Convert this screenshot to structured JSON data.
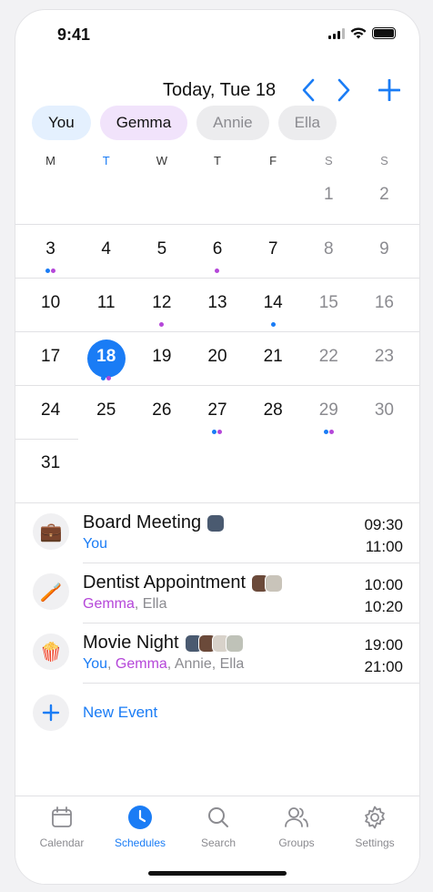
{
  "status_bar": {
    "time": "9:41"
  },
  "header": {
    "title": "Today, Tue 18"
  },
  "people": [
    {
      "name": "You",
      "state": "active",
      "color": "#1a7cf5"
    },
    {
      "name": "Gemma",
      "state": "active",
      "color": "#b547d9"
    },
    {
      "name": "Annie",
      "state": "inactive"
    },
    {
      "name": "Ella",
      "state": "inactive"
    }
  ],
  "calendar": {
    "weekdays": [
      "M",
      "T",
      "W",
      "T",
      "F",
      "S",
      "S"
    ],
    "today": 18,
    "weeks": [
      [
        null,
        null,
        null,
        null,
        null,
        "1",
        "2"
      ],
      [
        "3",
        "4",
        "5",
        "6",
        "7",
        "8",
        "9"
      ],
      [
        "10",
        "11",
        "12",
        "13",
        "14",
        "15",
        "16"
      ],
      [
        "17",
        "18",
        "19",
        "20",
        "21",
        "22",
        "23"
      ],
      [
        "24",
        "25",
        "26",
        "27",
        "28",
        "29",
        "30"
      ],
      [
        "31",
        null,
        null,
        null,
        null,
        null,
        null
      ]
    ],
    "event_dots": {
      "3": [
        "you",
        "gemma"
      ],
      "6": [
        "gemma"
      ],
      "12": [
        "gemma"
      ],
      "14": [
        "you"
      ],
      "18": [
        "you",
        "gemma"
      ],
      "27": [
        "you",
        "gemma"
      ],
      "29": [
        "you",
        "gemma"
      ]
    }
  },
  "events": [
    {
      "title": "Board Meeting",
      "icon": "briefcase-icon",
      "glyph": "💼",
      "attendees": [
        {
          "name": "You",
          "who": "you"
        }
      ],
      "start": "09:30",
      "end": "11:00",
      "avatars": [
        "#4a5a70"
      ]
    },
    {
      "title": "Dentist Appointment",
      "icon": "toothbrush-icon",
      "glyph": "🪥",
      "attendees": [
        {
          "name": "Gemma",
          "who": "gemma"
        },
        {
          "name": "Ella",
          "who": "other"
        }
      ],
      "start": "10:00",
      "end": "10:20",
      "avatars": [
        "#6b4a3a",
        "#c9c4ba"
      ]
    },
    {
      "title": "Movie Night",
      "icon": "popcorn-icon",
      "glyph": "🍿",
      "attendees": [
        {
          "name": "You",
          "who": "you"
        },
        {
          "name": "Gemma",
          "who": "gemma"
        },
        {
          "name": "Annie",
          "who": "other"
        },
        {
          "name": "Ella",
          "who": "other"
        }
      ],
      "start": "19:00",
      "end": "21:00",
      "avatars": [
        "#4a5a70",
        "#6b4a3a",
        "#d8d2ca",
        "#bfc2b8"
      ]
    }
  ],
  "new_event": {
    "label": "New Event"
  },
  "tabbar": [
    {
      "label": "Calendar",
      "icon": "calendar-icon",
      "active": false
    },
    {
      "label": "Schedules",
      "icon": "clock-icon",
      "active": true
    },
    {
      "label": "Search",
      "icon": "search-icon",
      "active": false
    },
    {
      "label": "Groups",
      "icon": "groups-icon",
      "active": false
    },
    {
      "label": "Settings",
      "icon": "gear-icon",
      "active": false
    }
  ],
  "colors": {
    "accent": "#1a7cf5",
    "gemma": "#b547d9",
    "muted": "#8b8b90"
  }
}
